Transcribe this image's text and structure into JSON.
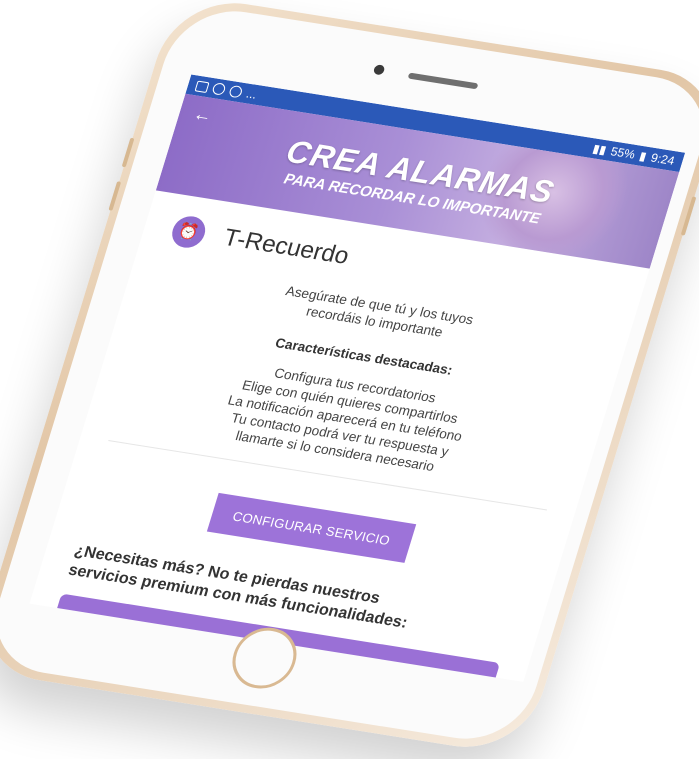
{
  "status_bar": {
    "battery": "55%",
    "time": "9:24",
    "notification_icons": [
      "gallery-icon",
      "whatsapp-icon",
      "at-icon"
    ],
    "more": "..."
  },
  "banner": {
    "title": "CREA ALARMAS",
    "subtitle": "PARA RECORDAR LO IMPORTANTE",
    "back_icon": "arrow-left-icon"
  },
  "app": {
    "icon": "alarm-clock-icon",
    "name": "T-Recuerdo",
    "description_line1": "Asegúrate de que tú y los tuyos",
    "description_line2": "recordáis lo importante",
    "features_title": "Características destacadas:",
    "features": [
      "Configura tus recordatorios",
      "Elige con quién quieres compartirlos",
      "La notificación aparecerá en tu teléfono",
      "Tu contacto podrá ver tu respuesta y",
      "llamarte si lo considera necesario"
    ]
  },
  "configure_button": "CONFIGURAR SERVICIO",
  "more_text_line1": "¿Necesitas más? No te pierdas nuestros",
  "more_text_line2": "servicios premium con más funcionalidades:",
  "colors": {
    "accent": "#9d73d9",
    "status_bar": "#2b59b8",
    "phone_frame": "#e2c6a6"
  }
}
